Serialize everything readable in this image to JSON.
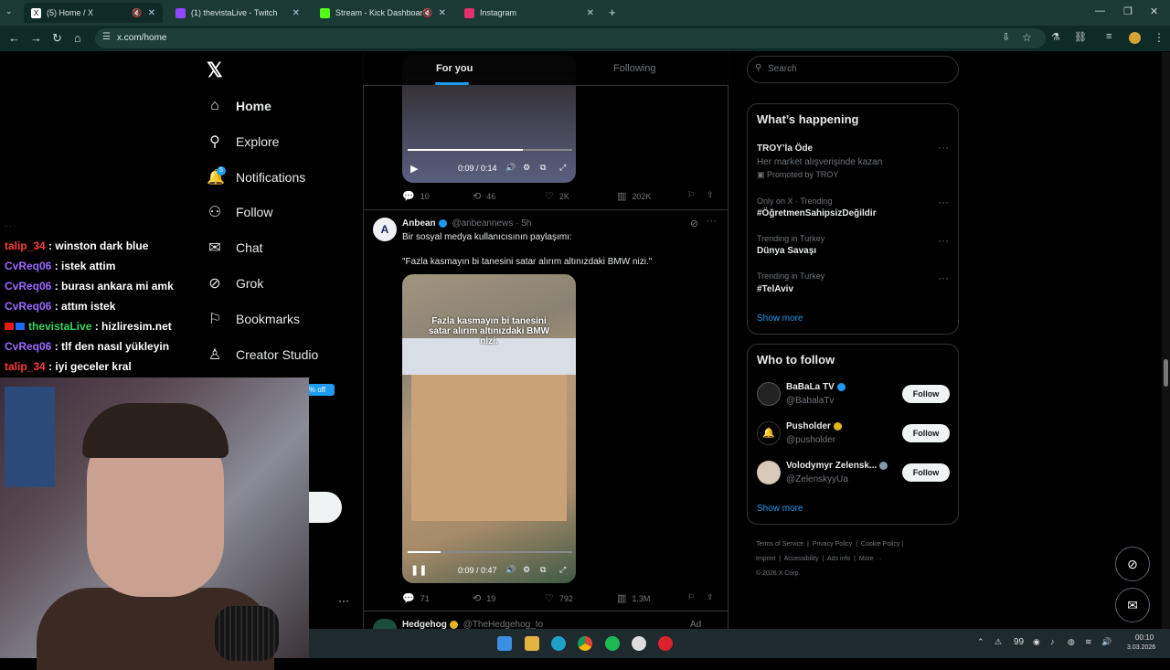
{
  "browser": {
    "tabs": [
      {
        "title": "(5) Home / X",
        "color": "#ffffff"
      },
      {
        "title": "(1) thevistaLive - Twitch",
        "color": "#9146ff"
      },
      {
        "title": "Stream - Kick Dashboard",
        "color": "#53fc18"
      },
      {
        "title": "Instagram",
        "color": "#e1306c"
      }
    ],
    "url": "x.com/home"
  },
  "sidebar": {
    "logo": "𝕏",
    "items": [
      {
        "label": "Home",
        "icon": "⌂"
      },
      {
        "label": "Explore",
        "icon": "⚲"
      },
      {
        "label": "Notifications",
        "icon": "🔔"
      },
      {
        "label": "Follow",
        "icon": "⚇"
      },
      {
        "label": "Chat",
        "icon": "✉"
      },
      {
        "label": "Grok",
        "icon": "⊘"
      },
      {
        "label": "Bookmarks",
        "icon": "⚐"
      },
      {
        "label": "Creator Studio",
        "icon": "♙"
      }
    ],
    "notif_badge": "5",
    "more": "···"
  },
  "chat": {
    "messages": [
      {
        "user": "talip_34",
        "color": "#ff3b3b",
        "text": ": winston dark blue"
      },
      {
        "user": "CvReq06",
        "color": "#9b6bff",
        "text": ": istek attim"
      },
      {
        "user": "CvReq06",
        "color": "#9b6bff",
        "text": ": burası ankara mi amk"
      },
      {
        "user": "CvReq06",
        "color": "#9b6bff",
        "text": ": attım istek"
      },
      {
        "user": "thevistaLive",
        "color": "#36d65f",
        "text": ": hizliresim.net"
      },
      {
        "user": "CvReq06",
        "color": "#9b6bff",
        "text": ": tlf den nasıl yükleyin"
      },
      {
        "user": "talip_34",
        "color": "#ff3b3b",
        "text": ": iyi geceler kral"
      }
    ],
    "promo": "% off"
  },
  "feed": {
    "tabs": [
      "For you",
      "Following"
    ],
    "post1": {
      "video_time": "0:09 / 0:14",
      "replies": "10",
      "reposts": "46",
      "likes": "2K",
      "views": "202K"
    },
    "post2": {
      "name": "Anbean",
      "handle": "@anbeannews · 5h",
      "text1": "Bir sosyal medya kullanıcısının paylaşımı:",
      "text2": "\"Fazla kasmayın bi tanesini satar alırım altınızdaki BMW nizi.\"",
      "caption": "Fazla kasmayın bi tanesini satar alırım altınızdaki BMW nizi.",
      "video_time": "0:09 / 0:47",
      "replies": "71",
      "reposts": "19",
      "likes": "792",
      "views": "1.3M"
    },
    "post3": {
      "name": "Hedgehog",
      "handle": "@TheHedgehog_Io",
      "ad": "Ad"
    }
  },
  "right": {
    "search_placeholder": "Search",
    "happening": {
      "title": "What’s happening",
      "promo_title": "TROY’la Öde",
      "promo_sub": "Her market alışverişinde kazan",
      "promo_by": "Promoted by TROY",
      "trends": [
        {
          "meta": "Only on X · Trending",
          "name": "#ÖğretmenSahipsizDeğildir"
        },
        {
          "meta": "Trending in Turkey",
          "name": "Dünya Savaşı"
        },
        {
          "meta": "Trending in Turkey",
          "name": "#TelAviv"
        }
      ],
      "show_more": "Show more"
    },
    "who": {
      "title": "Who to follow",
      "accounts": [
        {
          "name": "BaBaLa TV",
          "handle": "@BabalaTv"
        },
        {
          "name": "Pusholder",
          "handle": "@pusholder"
        },
        {
          "name": "Volodymyr Zelensk...",
          "handle": "@ZelenskyyUa"
        }
      ],
      "follow": "Follow",
      "show_more": "Show more"
    },
    "footer": {
      "line1": [
        "Terms of Service",
        "Privacy Policy",
        "Cookie Policy"
      ],
      "line2": [
        "Imprint",
        "Accessibility",
        "Ads info",
        "More ···"
      ],
      "copy": "© 2026 X Corp."
    }
  },
  "taskbar": {
    "temp": "99",
    "time": "00:10",
    "date": "3.03.2026"
  }
}
